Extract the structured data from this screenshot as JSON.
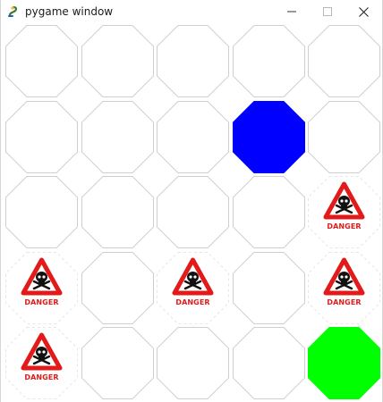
{
  "window": {
    "title": "pygame window",
    "app_icon": "pygame-snake-icon",
    "controls": [
      "minimize-icon",
      "maximize-icon",
      "close-icon"
    ]
  },
  "board": {
    "rows": 5,
    "cols": 5,
    "colors": {
      "empty_fill": "#ffffff",
      "empty_stroke": "#cfcfcf",
      "blue_piece": "#0000ff",
      "green_piece": "#00ff00",
      "danger_red": "#e21a1a"
    },
    "danger_label": "DANGER",
    "cells": [
      [
        "empty",
        "empty",
        "empty",
        "empty",
        "empty"
      ],
      [
        "empty",
        "empty",
        "empty",
        "blue",
        "empty"
      ],
      [
        "empty",
        "empty",
        "empty",
        "empty",
        "danger"
      ],
      [
        "danger",
        "empty",
        "danger",
        "empty",
        "danger"
      ],
      [
        "danger",
        "empty",
        "empty",
        "empty",
        "green"
      ]
    ]
  }
}
